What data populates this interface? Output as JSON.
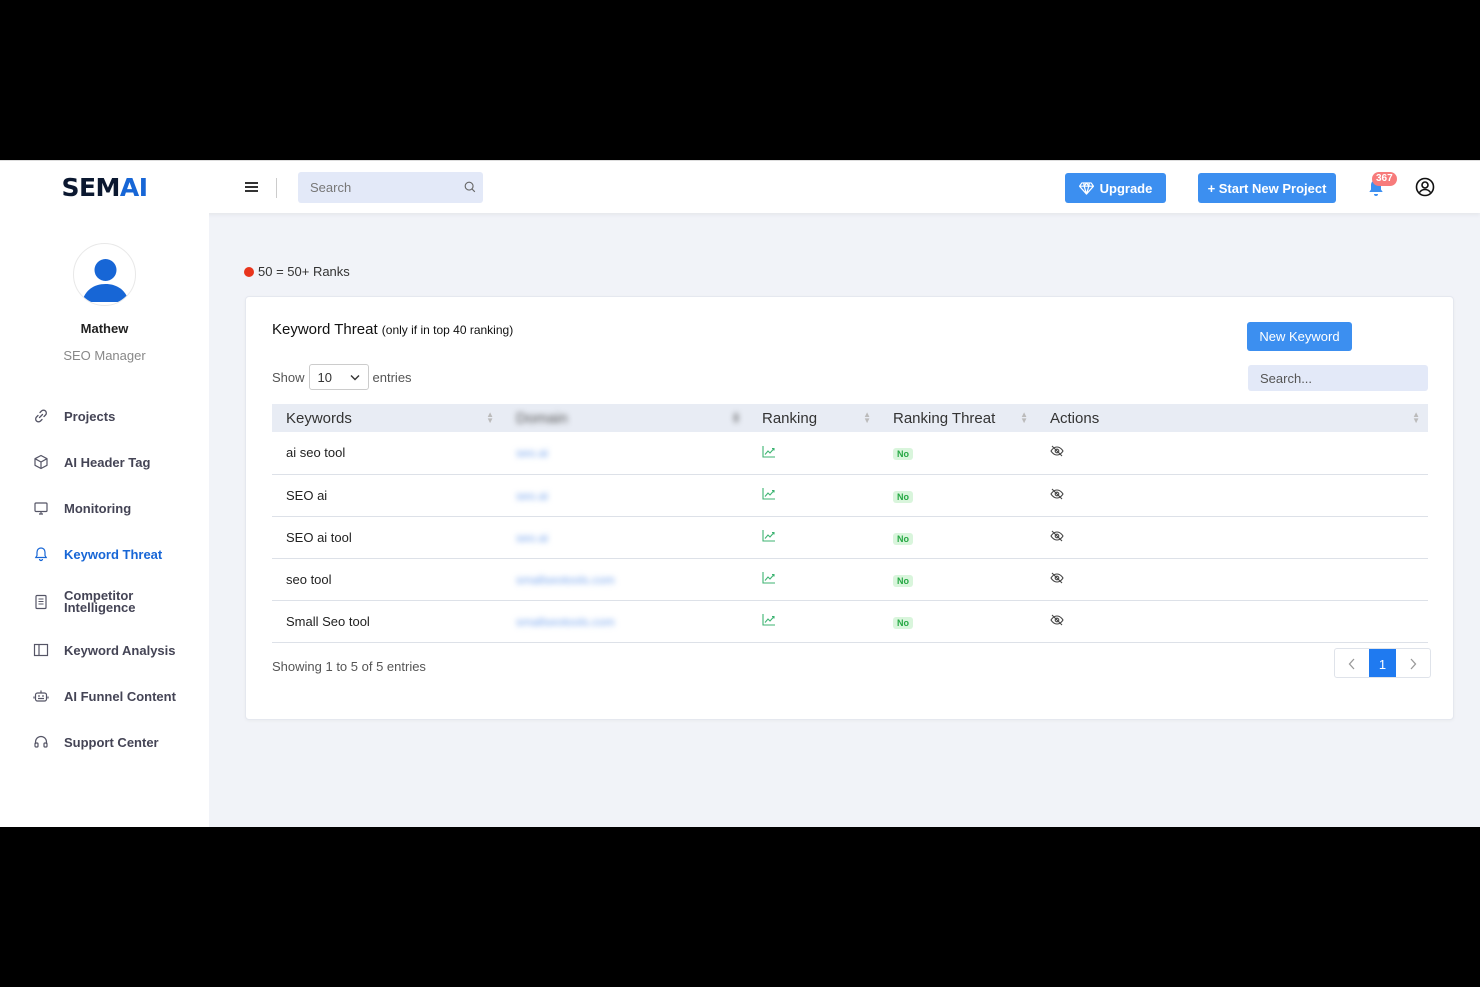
{
  "brand": {
    "logo_main": "SEM",
    "logo_accent": "AI"
  },
  "topbar": {
    "search_placeholder": "Search",
    "upgrade_label": "Upgrade",
    "start_project_label": "+ Start New Project",
    "notification_count": "367"
  },
  "profile": {
    "name": "Mathew",
    "role": "SEO Manager"
  },
  "sidebar": {
    "items": [
      {
        "label": "Projects",
        "icon": "link-icon"
      },
      {
        "label": "AI Header Tag",
        "icon": "cube-icon"
      },
      {
        "label": "Monitoring",
        "icon": "monitor-icon"
      },
      {
        "label": "Keyword Threat",
        "icon": "bell-icon",
        "active": true
      },
      {
        "label": "Competitor Intelligence",
        "icon": "document-icon"
      },
      {
        "label": "Keyword Analysis",
        "icon": "columns-icon"
      },
      {
        "label": "AI Funnel Content",
        "icon": "robot-icon"
      },
      {
        "label": "Support Center",
        "icon": "headset-icon"
      }
    ]
  },
  "legend": {
    "text": "50 = 50+ Ranks",
    "color": "#e8341c"
  },
  "card": {
    "title": "Keyword Threat",
    "subtitle": "(only if in top 40 ranking)",
    "new_keyword_label": "New Keyword",
    "show_label": "Show",
    "entries_value": "10",
    "entries_label": "entries",
    "search_placeholder": "Search...",
    "columns": [
      "Keywords",
      "Domain",
      "Ranking",
      "Ranking Threat",
      "Actions"
    ],
    "rows": [
      {
        "keyword": "ai seo tool",
        "domain": "seo.ai",
        "threat": "No"
      },
      {
        "keyword": "SEO ai",
        "domain": "seo.ai",
        "threat": "No"
      },
      {
        "keyword": "SEO ai tool",
        "domain": "seo.ai",
        "threat": "No"
      },
      {
        "keyword": "seo tool",
        "domain": "smallseotools.com",
        "threat": "No"
      },
      {
        "keyword": "Small Seo tool",
        "domain": "smallseotools.com",
        "threat": "No"
      }
    ],
    "footer_info": "Showing 1 to 5 of 5 entries",
    "current_page": "1"
  },
  "colors": {
    "accent": "#3c8ff0",
    "active_nav": "#1766d6",
    "badge": "#f77b7b"
  }
}
